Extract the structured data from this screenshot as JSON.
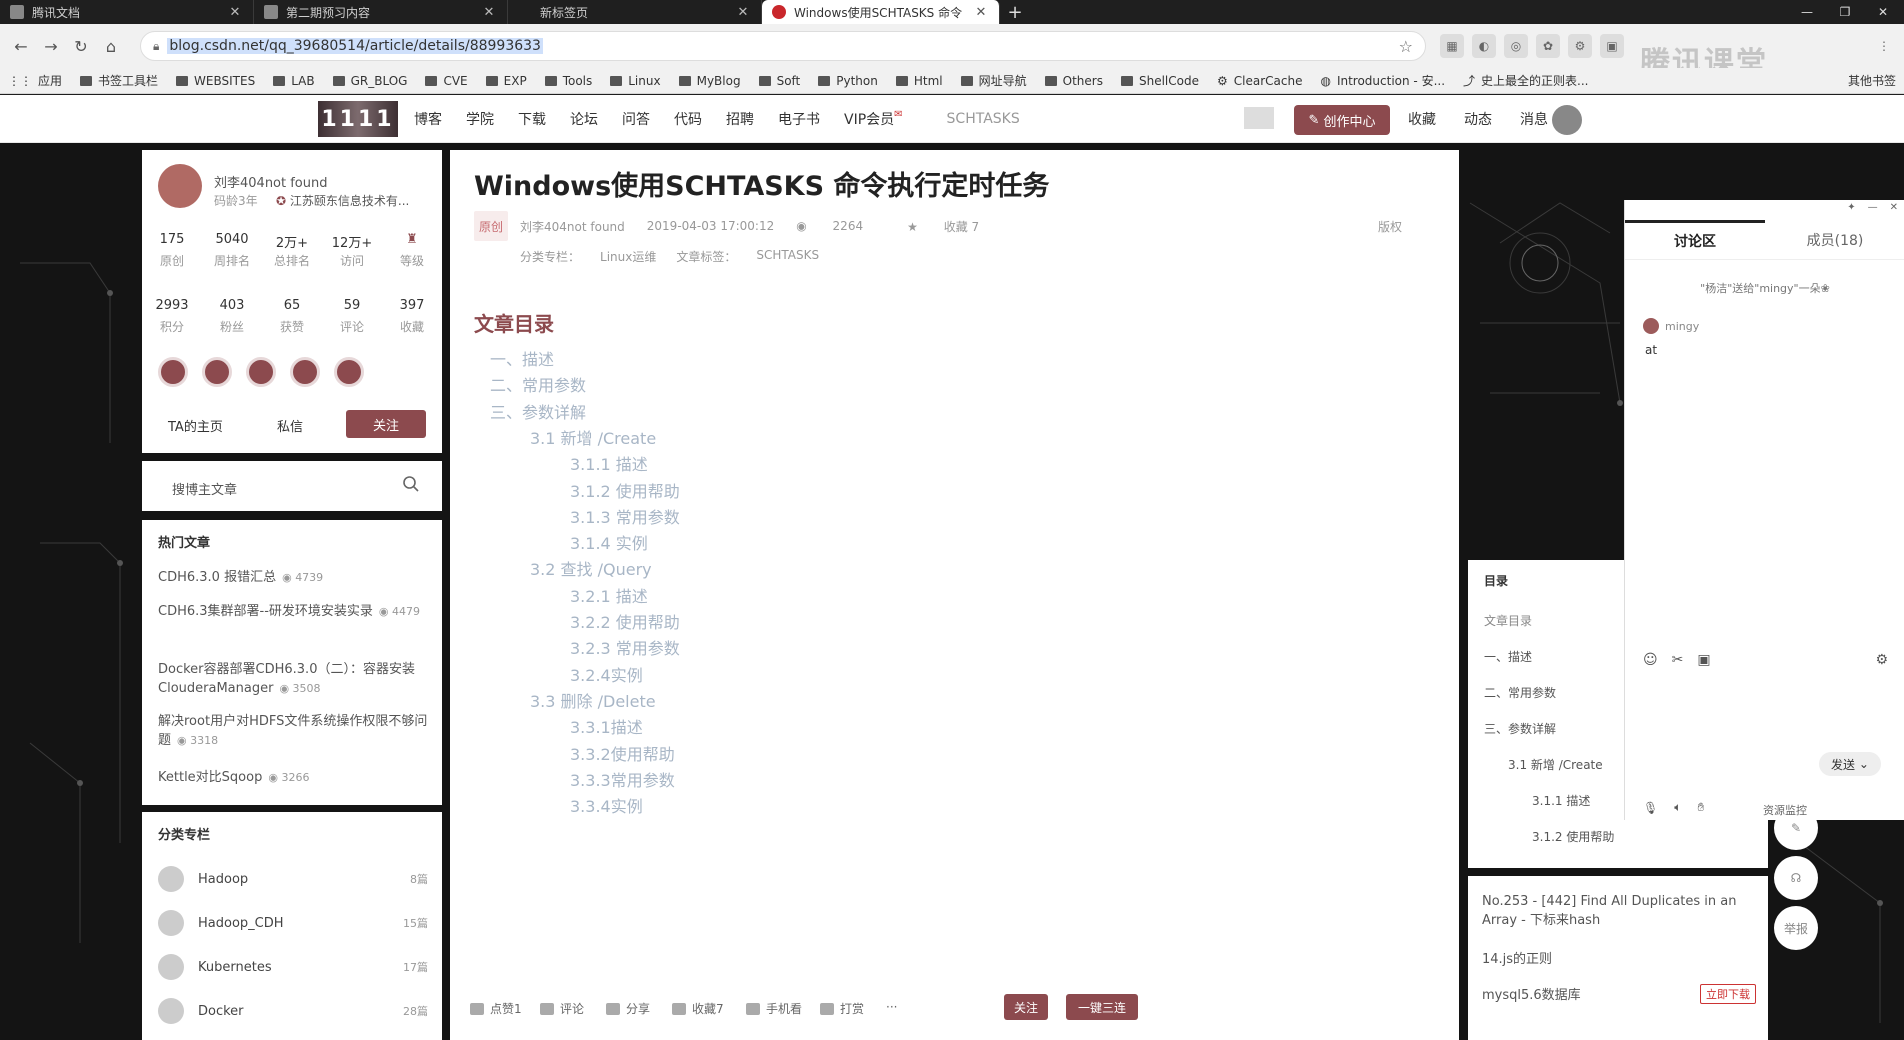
{
  "browser": {
    "tabs": [
      {
        "label": "腾讯文档",
        "active": false
      },
      {
        "label": "第二期预习内容",
        "active": false
      },
      {
        "label": "新标签页",
        "active": false
      },
      {
        "label": "Windows使用SCHTASKS 命令",
        "active": true
      }
    ],
    "new_tab": "+",
    "url": "blog.csdn.net/qq_39680514/article/details/88993633",
    "bookmarks": [
      "应用",
      "书签工具栏",
      "WEBSITES",
      "LAB",
      "GR_BLOG",
      "CVE",
      "EXP",
      "Tools",
      "Linux",
      "MyBlog",
      "Soft",
      "Python",
      "Html",
      "网址导航",
      "Others",
      "ShellCode",
      "ClearCache",
      "Introduction - 安...",
      "史上最全的正则表..."
    ],
    "other_bookmarks": "其他书签",
    "watermark": "腾讯课堂"
  },
  "csdn_header": {
    "logo": "1111",
    "nav": [
      "博客",
      "学院",
      "下载",
      "论坛",
      "问答",
      "代码",
      "招聘",
      "电子书",
      "VIP会员"
    ],
    "search_text": "SCHTASKS",
    "create_label": "创作中心",
    "right_nav": [
      "收藏",
      "动态",
      "消息"
    ]
  },
  "profile": {
    "name": "刘李404not found",
    "age": "码龄3年",
    "company": "江苏颐东信息技术有...",
    "stats1": [
      {
        "value": "175",
        "label": "原创"
      },
      {
        "value": "5040",
        "label": "周排名"
      },
      {
        "value": "2万+",
        "label": "总排名"
      },
      {
        "value": "12万+",
        "label": "访问"
      },
      {
        "value": "",
        "label": "等级"
      }
    ],
    "stats2": [
      {
        "value": "2993",
        "label": "积分"
      },
      {
        "value": "403",
        "label": "粉丝"
      },
      {
        "value": "65",
        "label": "获赞"
      },
      {
        "value": "59",
        "label": "评论"
      },
      {
        "value": "397",
        "label": "收藏"
      }
    ],
    "home_link": "TA的主页",
    "message_link": "私信",
    "follow_label": "关注"
  },
  "search_box": {
    "placeholder": "搜博主文章"
  },
  "hot_articles": {
    "title": "热门文章",
    "items": [
      {
        "title": "CDH6.3.0 报错汇总",
        "views": "4739"
      },
      {
        "title": "CDH6.3集群部署--研发环境安装实录",
        "views": "4479"
      },
      {
        "title": "Docker容器部署CDH6.3.0（二）：容器安装ClouderaManager",
        "views": "3508"
      },
      {
        "title": "解决root用户对HDFS文件系统操作权限不够问题",
        "views": "3318"
      },
      {
        "title": "Kettle对比Sqoop",
        "views": "3266"
      }
    ]
  },
  "categories": {
    "title": "分类专栏",
    "items": [
      {
        "name": "Hadoop",
        "count": "8篇"
      },
      {
        "name": "Hadoop_CDH",
        "count": "15篇"
      },
      {
        "name": "Kubernetes",
        "count": "17篇"
      },
      {
        "name": "Docker",
        "count": "28篇"
      }
    ]
  },
  "article": {
    "title": "Windows使用SCHTASKS 命令执行定时任务",
    "original_badge": "原创",
    "author": "刘李404not found",
    "date": "2019-04-03 17:00:12",
    "views": "2264",
    "favorites": "收藏 7",
    "copyright": "版权",
    "column_label": "分类专栏：",
    "column": "Linux运维",
    "tags_label": "文章标签：",
    "tag": "SCHTASKS",
    "toc_title": "文章目录",
    "toc": [
      {
        "text": "一、描述",
        "level": 1
      },
      {
        "text": "二、常用参数",
        "level": 1
      },
      {
        "text": "三、参数详解",
        "level": 1
      },
      {
        "text": "3.1 新增 /Create",
        "level": 2
      },
      {
        "text": "3.1.1 描述",
        "level": 3
      },
      {
        "text": "3.1.2 使用帮助",
        "level": 3
      },
      {
        "text": "3.1.3 常用参数",
        "level": 3
      },
      {
        "text": "3.1.4 实例",
        "level": 3
      },
      {
        "text": "3.2 查找 /Query",
        "level": 2
      },
      {
        "text": "3.2.1 描述",
        "level": 3
      },
      {
        "text": "3.2.2 使用帮助",
        "level": 3
      },
      {
        "text": "3.2.3 常用参数",
        "level": 3
      },
      {
        "text": "3.2.4实例",
        "level": 3
      },
      {
        "text": "3.3 删除 /Delete",
        "level": 2
      },
      {
        "text": "3.3.1描述",
        "level": 3
      },
      {
        "text": "3.3.2使用帮助",
        "level": 3
      },
      {
        "text": "3.3.3常用参数",
        "level": 3
      },
      {
        "text": "3.3.4实例",
        "level": 3
      }
    ]
  },
  "action_bar": {
    "like": "点赞1",
    "comment": "评论",
    "share": "分享",
    "favorite": "收藏7",
    "mobile": "手机看",
    "reward": "打赏",
    "more": "···",
    "follow": "关注",
    "triple": "一键三连"
  },
  "right_toc": {
    "title": "目录",
    "items": [
      "文章目录",
      "一、描述",
      "二、常用参数",
      "三、参数详解",
      "3.1 新增 /Create",
      "3.1.1 描述",
      "3.1.2 使用帮助"
    ]
  },
  "recommendations": [
    "No.253 - [442] Find All Duplicates in an Array - 下标来hash",
    "14.js的正则",
    "mysql5.6数据库"
  ],
  "download_label": "立即下载",
  "round_buttons": {
    "report": "举报"
  },
  "chat": {
    "tab_discussion": "讨论区",
    "tab_members": "成员(18)",
    "system_msg": "\"杨洁\"送给\"mingy\"一朵❀",
    "sender": "mingy",
    "message": "at",
    "send_label": "发送",
    "resource_monitor": "资源监控"
  },
  "colors": {
    "brand": "#8c4a4e",
    "toc_link": "#a8b6c6"
  }
}
